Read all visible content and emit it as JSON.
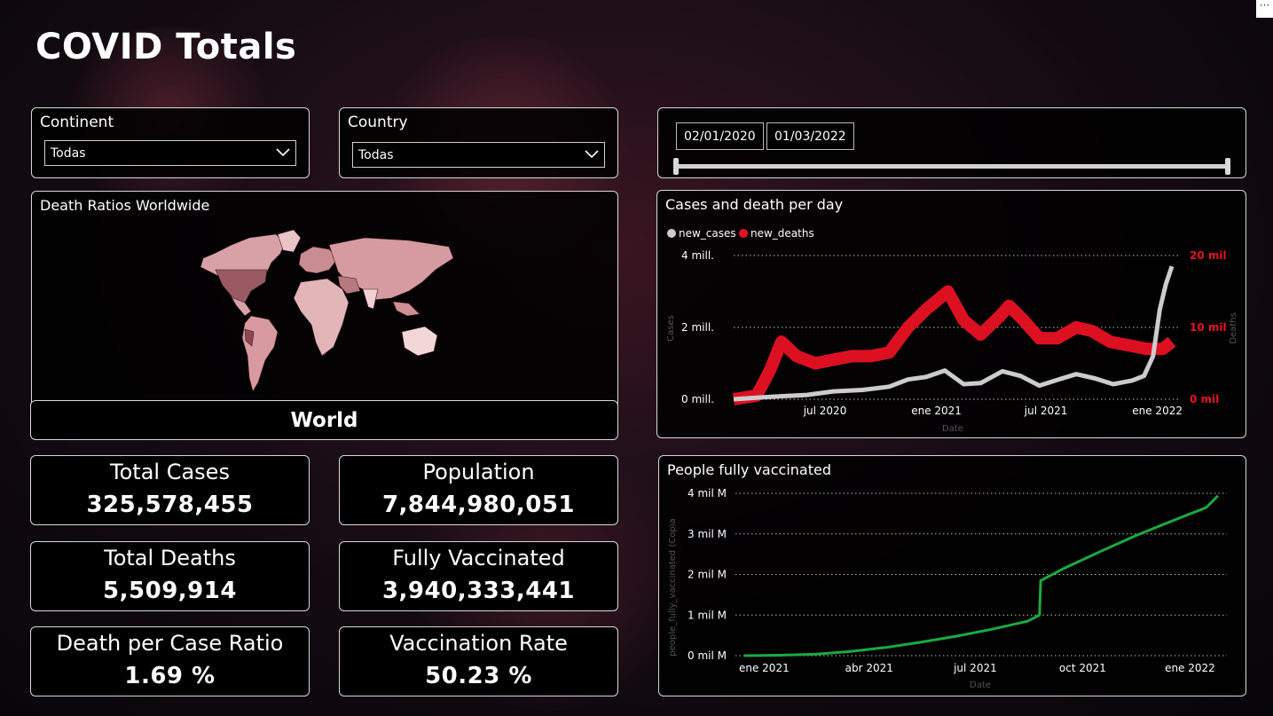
{
  "page": {
    "title": "COVID Totals"
  },
  "slicers": {
    "continent": {
      "label": "Continent",
      "value": "Todas"
    },
    "country": {
      "label": "Country",
      "value": "Todas"
    },
    "date": {
      "start": "02/01/2020",
      "end": "01/03/2022"
    }
  },
  "map": {
    "title": "Death Ratios Worldwide",
    "selection": "World"
  },
  "kpis": {
    "total_cases": {
      "label": "Total Cases",
      "value": "325,578,455"
    },
    "population": {
      "label": "Population",
      "value": "7,844,980,051"
    },
    "total_deaths": {
      "label": "Total Deaths",
      "value": "5,509,914"
    },
    "fully_vaccinated": {
      "label": "Fully Vaccinated",
      "value": "3,940,333,441"
    },
    "death_ratio": {
      "label": "Death per Case Ratio",
      "value": "1.69 %"
    },
    "vaccination_rate": {
      "label": "Vaccination Rate",
      "value": "50.23 %"
    }
  },
  "colors": {
    "cases": "#cccccc",
    "deaths": "#e81123",
    "vaccinated": "#1aab40",
    "deaths_axis": "#e81123"
  },
  "chart_data": [
    {
      "type": "line",
      "title": "Cases and death per day",
      "legend": [
        "new_cases",
        "new_deaths"
      ],
      "legend_placement": "top-left",
      "xlabel": "Date",
      "ylabel": "Cases",
      "y2label": "Deaths",
      "x_ticks": [
        "jul 2020",
        "ene 2021",
        "jul 2021",
        "ene 2022"
      ],
      "y_ticks": [
        "0 mill.",
        "2 mill.",
        "4 mill."
      ],
      "y2_ticks": [
        "0 mil",
        "10 mil",
        "20 mil"
      ],
      "ylim": [
        0,
        4000000
      ],
      "y2lim": [
        0,
        20000
      ],
      "grid": true,
      "series": [
        {
          "name": "new_cases",
          "x": [
            "2020-02-01",
            "2020-03-15",
            "2020-04-15",
            "2020-06-01",
            "2020-07-15",
            "2020-09-01",
            "2020-10-15",
            "2020-11-15",
            "2020-12-15",
            "2021-01-15",
            "2021-02-15",
            "2021-03-15",
            "2021-04-20",
            "2021-05-20",
            "2021-06-20",
            "2021-07-20",
            "2021-08-20",
            "2021-09-20",
            "2021-10-20",
            "2021-11-20",
            "2021-12-10",
            "2021-12-25",
            "2022-01-05",
            "2022-01-15",
            "2022-01-25"
          ],
          "values": [
            0,
            50000,
            80000,
            120000,
            220000,
            260000,
            350000,
            550000,
            620000,
            800000,
            420000,
            450000,
            780000,
            650000,
            380000,
            540000,
            700000,
            580000,
            420000,
            520000,
            650000,
            1200000,
            2500000,
            3200000,
            3700000
          ]
        },
        {
          "name": "new_deaths",
          "x": [
            "2020-02-01",
            "2020-03-10",
            "2020-04-01",
            "2020-04-20",
            "2020-05-15",
            "2020-06-15",
            "2020-07-15",
            "2020-08-15",
            "2020-09-15",
            "2020-10-15",
            "2020-11-15",
            "2020-12-15",
            "2021-01-20",
            "2021-02-15",
            "2021-03-15",
            "2021-04-15",
            "2021-05-01",
            "2021-05-25",
            "2021-06-20",
            "2021-07-20",
            "2021-08-20",
            "2021-09-15",
            "2021-10-15",
            "2021-11-15",
            "2021-12-15",
            "2022-01-10",
            "2022-01-25"
          ],
          "values": [
            0,
            500,
            4000,
            8000,
            6000,
            5000,
            5500,
            6000,
            6000,
            6500,
            10000,
            12500,
            15000,
            11000,
            9000,
            11500,
            13000,
            11000,
            8500,
            8500,
            10000,
            9500,
            8000,
            7500,
            7000,
            7000,
            8000
          ]
        }
      ]
    },
    {
      "type": "line",
      "title": "People fully vaccinated",
      "xlabel": "Date",
      "ylabel": "people_fully_vaccinated (Copia",
      "x_ticks": [
        "ene 2021",
        "abr 2021",
        "jul 2021",
        "oct 2021",
        "ene 2022"
      ],
      "y_ticks": [
        "0 mil M",
        "1 mil M",
        "2 mil M",
        "3 mil M",
        "4 mil M"
      ],
      "ylim": [
        0,
        4000000000
      ],
      "grid": true,
      "series": [
        {
          "name": "people_fully_vaccinated",
          "x": [
            "2020-12-15",
            "2021-01-15",
            "2021-02-15",
            "2021-03-15",
            "2021-04-15",
            "2021-05-15",
            "2021-06-15",
            "2021-07-15",
            "2021-08-15",
            "2021-08-25",
            "2021-08-26",
            "2021-09-15",
            "2021-10-15",
            "2021-11-15",
            "2021-12-15",
            "2022-01-15",
            "2022-01-25"
          ],
          "values": [
            0,
            10000000,
            40000000,
            100000000,
            200000000,
            330000000,
            480000000,
            650000000,
            850000000,
            1000000000,
            1850000000,
            2150000000,
            2550000000,
            2950000000,
            3300000000,
            3650000000,
            3940000000
          ]
        }
      ]
    }
  ]
}
